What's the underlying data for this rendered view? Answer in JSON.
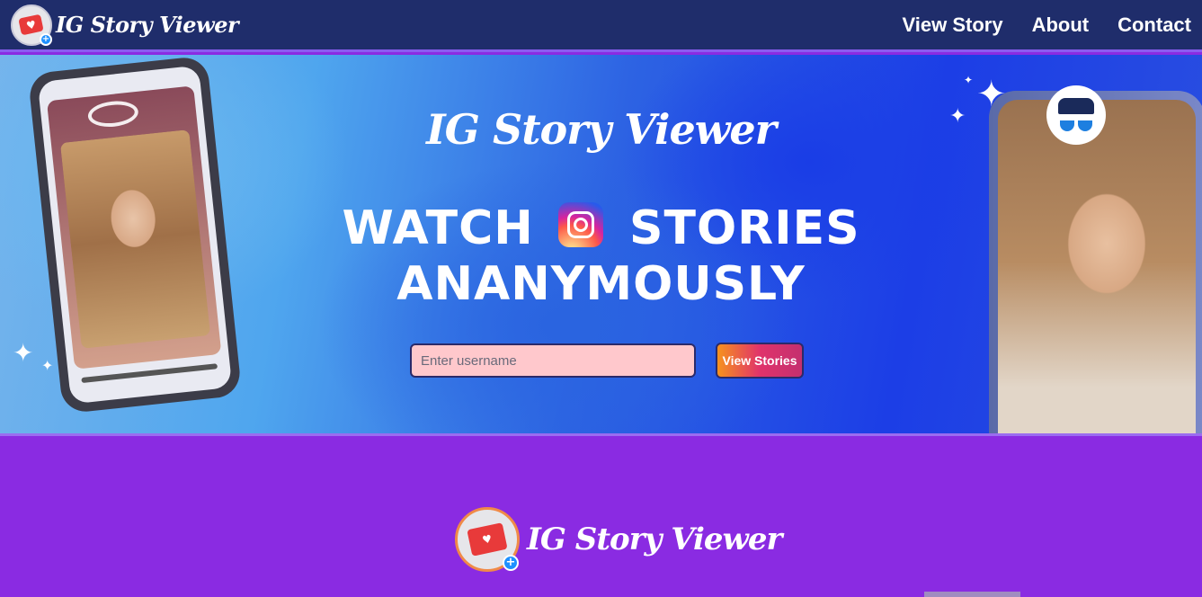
{
  "brand": {
    "name": "IG Story Viewer"
  },
  "nav": {
    "links": [
      "View Story",
      "About",
      "Contact"
    ]
  },
  "hero": {
    "title": "IG Story Viewer",
    "headline_line1_pre": "WATCH",
    "headline_line1_post": "STORIES",
    "headline_line2": "ANANYMOUSLY",
    "search": {
      "placeholder": "Enter username",
      "value": ""
    },
    "button_label": "View Stories"
  },
  "footer": {
    "brand_name": "IG Story Viewer"
  },
  "colors": {
    "nav_bg": "#1f2d6b",
    "accent_purple": "#8a2be2",
    "input_bg": "#ffc8cc"
  },
  "icons": {
    "logo": "heart-card-icon",
    "instagram": "instagram-icon",
    "spy": "incognito-icon",
    "eye": "eye-slash-icon"
  }
}
